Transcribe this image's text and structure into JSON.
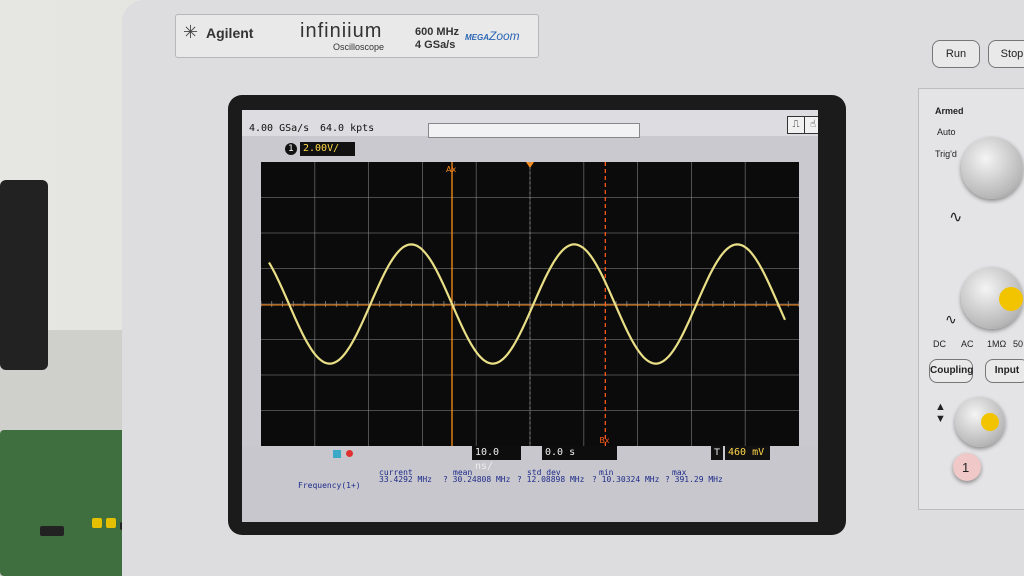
{
  "brand": {
    "logo_icon": "agilent-spark-icon",
    "name": "Agilent",
    "model": "infiniium",
    "subtitle": "Oscilloscope",
    "bandwidth": "600 MHz",
    "sample_rate": "4 GSa/s",
    "mega": "MEGA",
    "zoom": "Zoom"
  },
  "panel": {
    "run": "Run",
    "stop": "Stop",
    "armed": "Armed",
    "auto": "Auto",
    "trigd": "Trig'd",
    "dc": "DC",
    "ac": "AC",
    "ohm": "1MΩ",
    "fifty": "50",
    "coupling": "Coupling",
    "input": "Input",
    "channel": "1"
  },
  "status": {
    "sample_rate": "4.00 GSa/s",
    "memory": "64.0 kpts"
  },
  "channel": {
    "number": "1",
    "scale": "2.00V/"
  },
  "timebase": {
    "scale": "10.0 ns/",
    "position": "0.0 s"
  },
  "trigger": {
    "icon": "T",
    "level": "460 mV"
  },
  "markers": {
    "ax": "Ax",
    "bx": "Bx"
  },
  "measurement": {
    "label": "Frequency(1+)",
    "headers": [
      "current",
      "mean",
      "std dev",
      "min",
      "max"
    ],
    "values": [
      "33.4292 MHz",
      "? 30.24808 MHz",
      "? 12.08898 MHz",
      "? 10.30324 MHz",
      "? 391.29 MHz"
    ]
  },
  "waveform": {
    "channel": "1",
    "shape": "sine",
    "color": "#e9df86",
    "frequency_mhz": 33.43,
    "amplitude_div": 1.2,
    "cycles_on_screen": 3.3
  },
  "colors": {
    "trace": "#e9df86",
    "marker": "#ff8c1a",
    "grid": "#8a8a8a",
    "screen_bg": "#0b0b0b"
  }
}
